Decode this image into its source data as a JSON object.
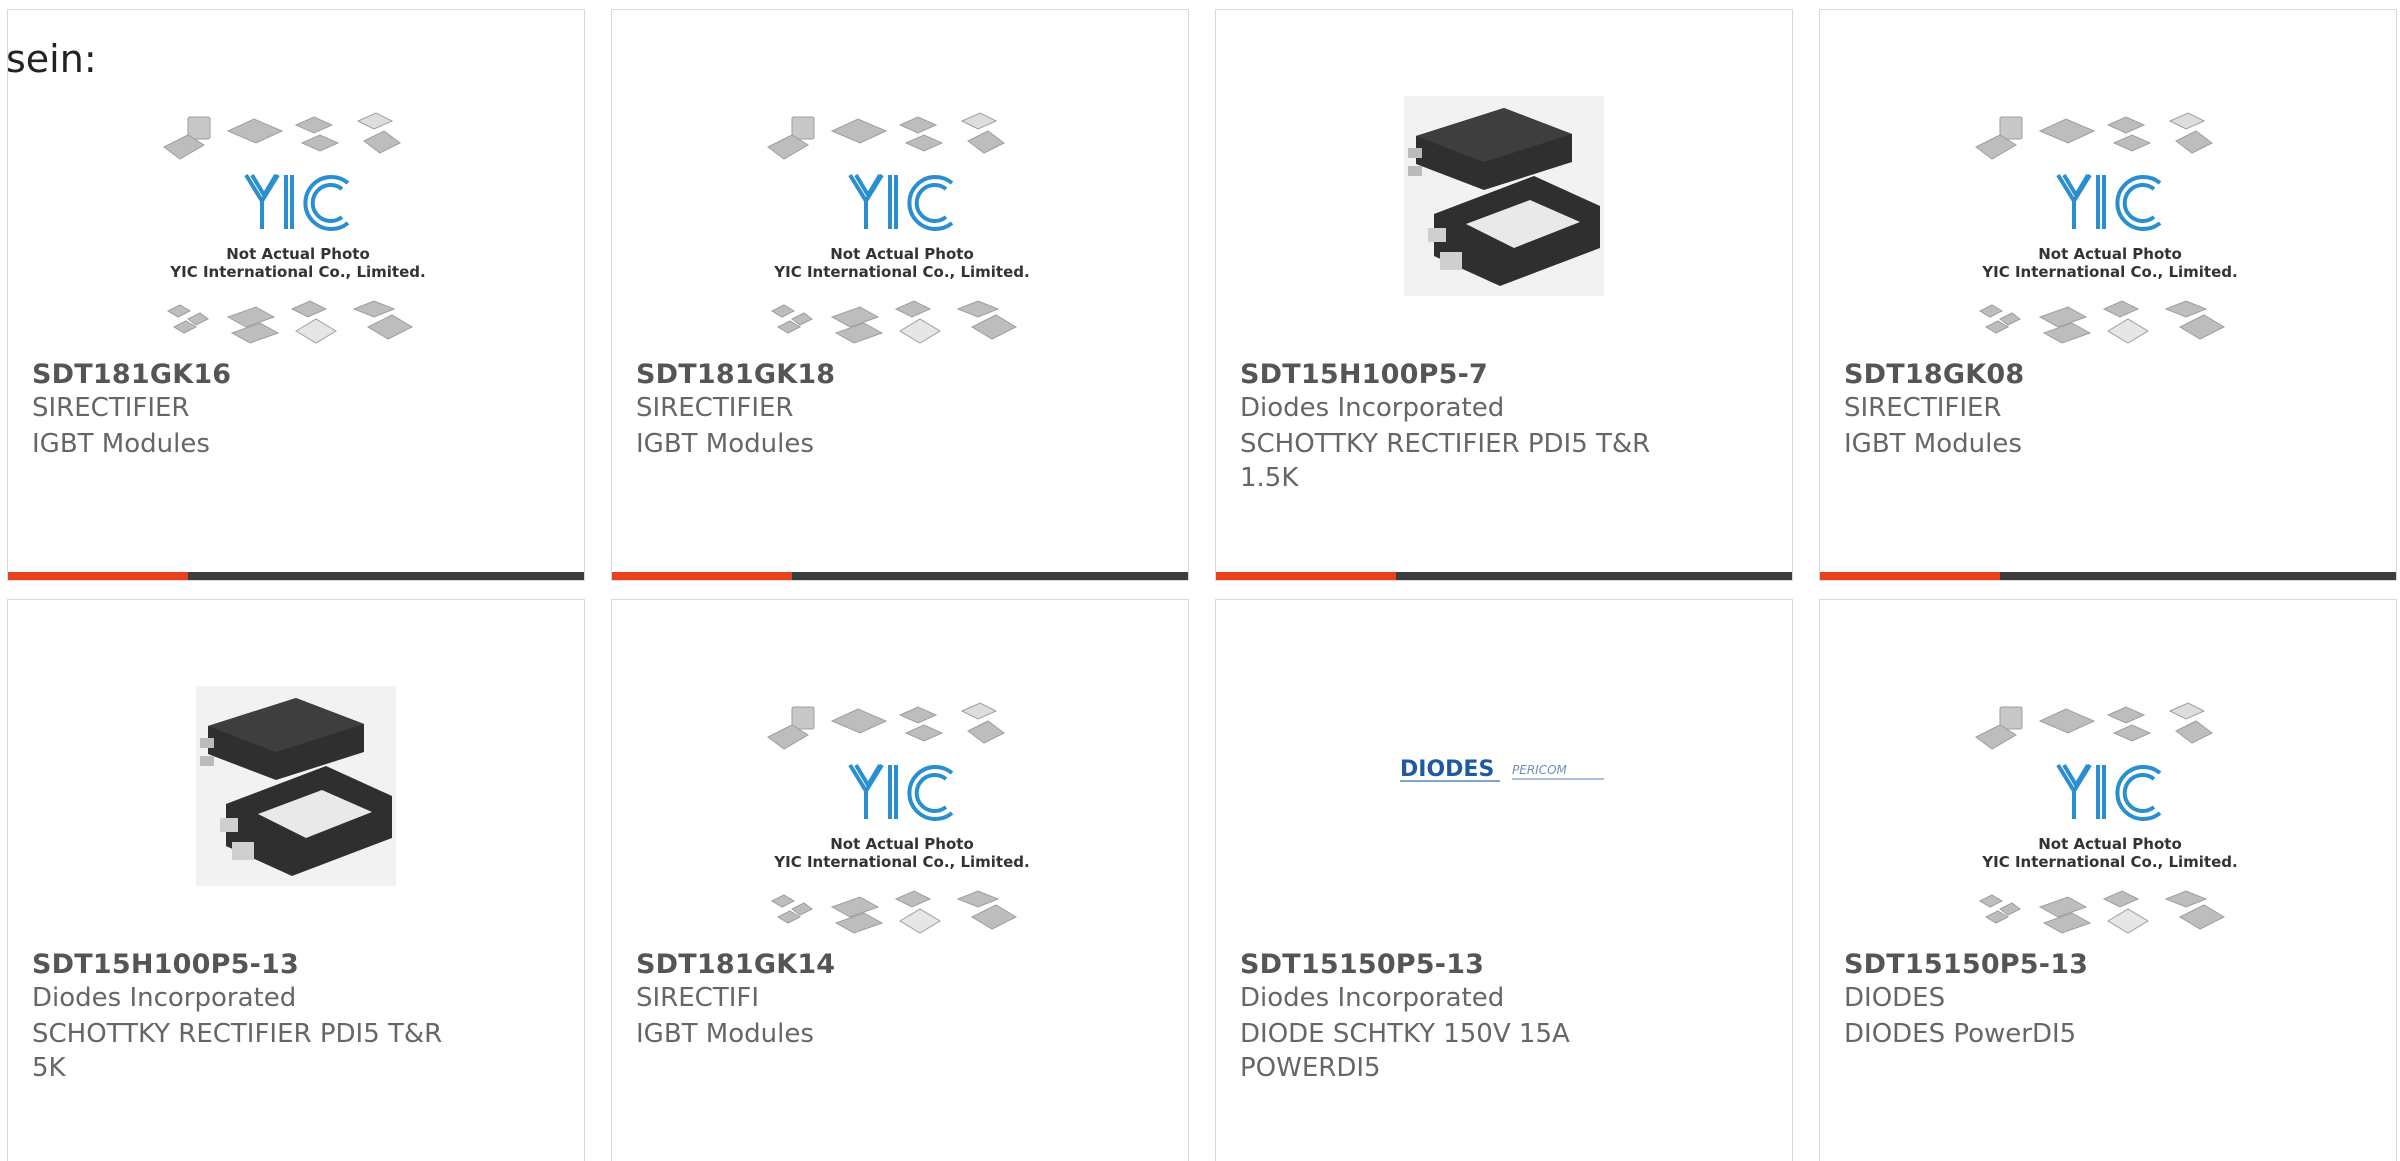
{
  "intro_text": "sein:",
  "placeholder_caption": {
    "line1": "Not Actual Photo",
    "line2": "YIC International Co., Limited."
  },
  "placeholder_logo": "YIC",
  "colors": {
    "accent": "#e8411f",
    "bar": "#3d3d3d",
    "border": "#d9d9d9",
    "text": "#666666",
    "part": "#555555",
    "yic_blue": "#2a8fd0"
  },
  "products": [
    {
      "part": "SDT181GK16",
      "maker": "SIRECTIFIER",
      "desc": "IGBT Modules",
      "image": "yic-placeholder"
    },
    {
      "part": "SDT181GK18",
      "maker": "SIRECTIFIER",
      "desc": "IGBT Modules",
      "image": "yic-placeholder"
    },
    {
      "part": "SDT15H100P5-7",
      "maker": "Diodes Incorporated",
      "desc": "SCHOTTKY RECTIFIER PDI5 T&R 1.5K",
      "image": "powerdi5-package"
    },
    {
      "part": "SDT18GK08",
      "maker": "SIRECTIFIER",
      "desc": "IGBT Modules",
      "image": "yic-placeholder"
    },
    {
      "part": "SDT15H100P5-13",
      "maker": "Diodes Incorporated",
      "desc": "SCHOTTKY RECTIFIER PDI5 T&R 5K",
      "image": "powerdi5-package"
    },
    {
      "part": "SDT181GK14",
      "maker": "SIRECTIFI",
      "desc": "IGBT Modules",
      "image": "yic-placeholder"
    },
    {
      "part": "SDT15150P5-13",
      "maker": "Diodes Incorporated",
      "desc": "DIODE SCHTKY 150V 15A POWERDI5",
      "image": "diodes-pericom-logo"
    },
    {
      "part": "SDT15150P5-13",
      "maker": "DIODES",
      "desc": "DIODES PowerDI5",
      "image": "yic-placeholder"
    }
  ],
  "brand_logo": {
    "left": "DIODES",
    "right": "PERICOM"
  }
}
